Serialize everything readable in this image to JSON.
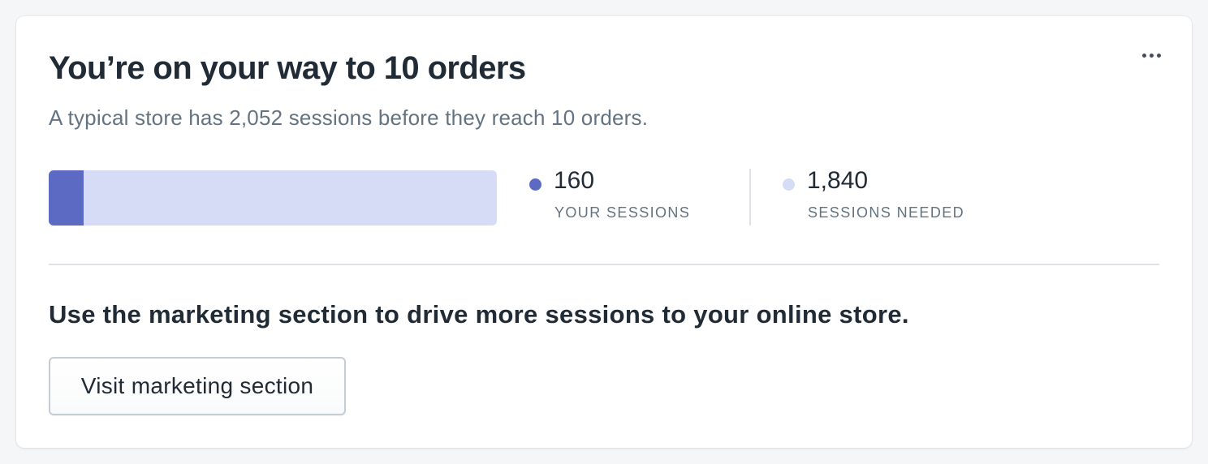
{
  "card": {
    "title": "You’re on your way to 10 orders",
    "subtitle": "A typical store has 2,052 sessions before they reach 10 orders.",
    "menu_icon": "more-horizontal-icon"
  },
  "progress": {
    "fraction": 0.078,
    "filled_color": "#5c6ac4",
    "remaining_color": "#d7dcf6"
  },
  "stats": [
    {
      "value": "160",
      "label": "YOUR SESSIONS",
      "color": "#5c6ac4"
    },
    {
      "value": "1,840",
      "label": "SESSIONS NEEDED",
      "color": "#d7dcf6"
    }
  ],
  "cta": {
    "text": "Use the marketing section to drive more sessions to your online store.",
    "button_label": "Visit marketing section"
  }
}
